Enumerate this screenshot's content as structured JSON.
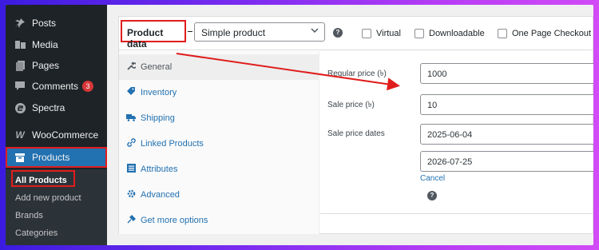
{
  "sidebar": {
    "items": [
      {
        "label": "Posts",
        "icon": "pin-icon"
      },
      {
        "label": "Media",
        "icon": "media-icon"
      },
      {
        "label": "Pages",
        "icon": "pages-icon"
      },
      {
        "label": "Comments",
        "icon": "comment-icon",
        "badge": "3"
      },
      {
        "label": "Spectra",
        "icon": "spectra-icon"
      },
      {
        "label": "WooCommerce",
        "icon": "woocommerce-icon"
      },
      {
        "label": "Products",
        "icon": "archive-icon"
      }
    ],
    "submenu": [
      "All Products",
      "Add new product",
      "Brands",
      "Categories"
    ]
  },
  "product_data": {
    "title": "Product data",
    "product_type": "Simple product",
    "options": [
      "Virtual",
      "Downloadable",
      "One Page Checkout"
    ]
  },
  "tabs": [
    "General",
    "Inventory",
    "Shipping",
    "Linked Products",
    "Attributes",
    "Advanced",
    "Get more options"
  ],
  "fields": {
    "regular_price_label": "Regular price (৳)",
    "regular_price": "1000",
    "sale_price_label": "Sale price (৳)",
    "sale_price": "10",
    "sale_dates_label": "Sale price dates",
    "sale_from": "2025-06-04",
    "sale_to": "2026-07-25",
    "cancel": "Cancel"
  },
  "colors": {
    "accent": "#2271b1",
    "highlight": "#e01d1d",
    "sidebar": "#1d2327"
  }
}
